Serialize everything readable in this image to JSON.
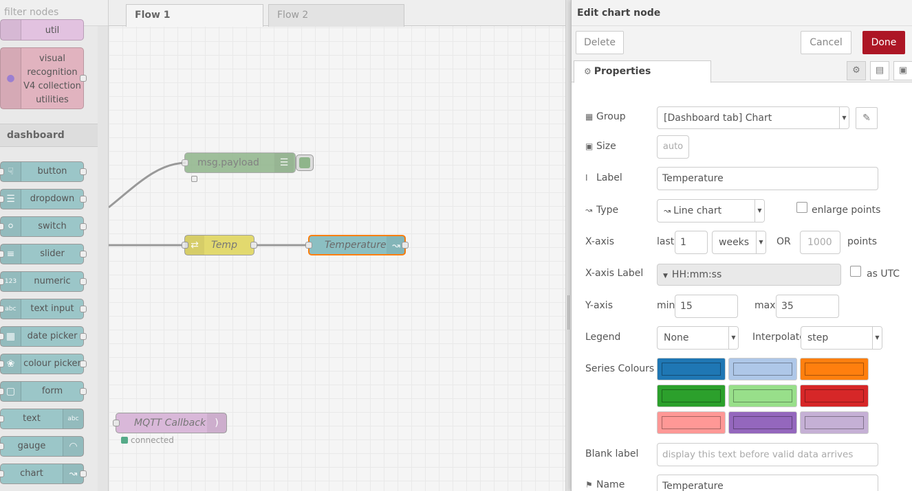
{
  "palette": {
    "filter_placeholder": "filter nodes",
    "top_nodes": [
      {
        "label": "util",
        "color": "#e2c2e0"
      },
      {
        "label_lines": [
          "visual",
          "recognition",
          "V4 collection",
          "utilities"
        ],
        "color": "#e1b3bf"
      }
    ],
    "category": "dashboard",
    "dashboard_nodes": [
      {
        "label": "button",
        "icon": "hand-pointer-icon"
      },
      {
        "label": "dropdown",
        "icon": "list-icon"
      },
      {
        "label": "switch",
        "icon": "toggle-icon"
      },
      {
        "label": "slider",
        "icon": "sliders-icon"
      },
      {
        "label": "numeric",
        "icon": "numeric-icon"
      },
      {
        "label": "text input",
        "icon": "text-input-icon"
      },
      {
        "label": "date picker",
        "icon": "calendar-icon"
      },
      {
        "label": "colour picker",
        "icon": "palette-icon"
      },
      {
        "label": "form",
        "icon": "form-icon"
      },
      {
        "label": "text",
        "icon": "text-icon"
      },
      {
        "label": "gauge",
        "icon": "gauge-icon"
      },
      {
        "label": "chart",
        "icon": "chart-icon"
      }
    ],
    "node_color": "#9fcbcd"
  },
  "workspace": {
    "tabs": [
      "Flow 1",
      "Flow 2"
    ],
    "nodes": {
      "debug": "msg.payload",
      "change": "Temp",
      "chart": "Temperature",
      "mqtt": "MQTT Callback",
      "mqtt_status": "connected"
    },
    "colors": {
      "debug": "#8fb58b",
      "change": "#e2d96e",
      "chart": "#8bbfc2",
      "mqtt": "#d9b8d9"
    }
  },
  "tray": {
    "title": "Edit chart node",
    "delete_label": "Delete",
    "cancel_label": "Cancel",
    "done_label": "Done",
    "properties_tab": "Properties",
    "group": {
      "label": "Group",
      "value": "[Dashboard tab] Chart"
    },
    "size": {
      "label": "Size",
      "value": "auto"
    },
    "label": {
      "label": "Label",
      "value": "Temperature"
    },
    "type": {
      "label": "Type",
      "value": "Line chart",
      "enlarge_label": "enlarge points"
    },
    "xaxis": {
      "label": "X-axis",
      "last_label": "last",
      "last_value": "1",
      "unit": "weeks",
      "or_label": "OR",
      "points_placeholder": "1000",
      "points_label": "points"
    },
    "xaxis_label": {
      "label": "X-axis Label",
      "value": "HH:mm:ss",
      "utc_label": "as UTC"
    },
    "yaxis": {
      "label": "Y-axis",
      "min_label": "min",
      "min_value": "15",
      "max_label": "max",
      "max_value": "35"
    },
    "legend": {
      "label": "Legend",
      "value": "None",
      "interpolate_label": "Interpolate",
      "interpolate_value": "step"
    },
    "series": {
      "label": "Series Colours",
      "colors": [
        "#1f77b4",
        "#aec7e8",
        "#ff7f0e",
        "#2ca02c",
        "#98df8a",
        "#d62728",
        "#ff9896",
        "#9467bd",
        "#c5b0d5"
      ]
    },
    "blank": {
      "label": "Blank label",
      "placeholder": "display this text before valid data arrives"
    },
    "name": {
      "label": "Name",
      "value": "Temperature"
    }
  }
}
